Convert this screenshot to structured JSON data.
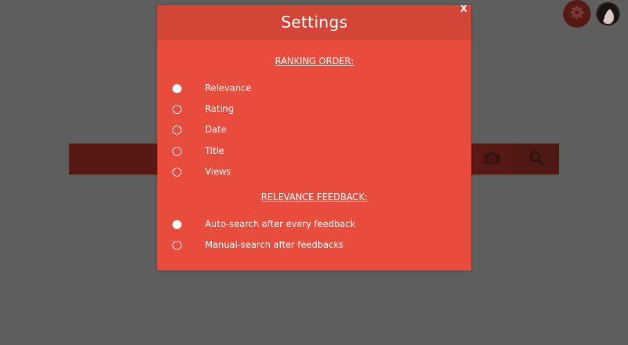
{
  "modal": {
    "title": "Settings",
    "close_label": "X"
  },
  "ranking": {
    "heading": "RANKING ORDER:",
    "options": [
      {
        "label": "Relevance",
        "selected": true
      },
      {
        "label": "Rating",
        "selected": false
      },
      {
        "label": "Date",
        "selected": false
      },
      {
        "label": "Title",
        "selected": false
      },
      {
        "label": "Views",
        "selected": false
      }
    ]
  },
  "feedback": {
    "heading": "RELEVANCE FEEDBACK:",
    "options": [
      {
        "label": "Auto-search after every feedback",
        "selected": true
      },
      {
        "label": "Manual-search after feedbacks",
        "selected": false
      }
    ]
  },
  "icons": {
    "camera": "camera-icon",
    "search": "search-icon",
    "settings": "gear-icon"
  },
  "colors": {
    "overlay": "#5e5e5e",
    "modal_body": "#e84c3d",
    "modal_header": "#d24637",
    "search_bar": "#571914",
    "gear_button": "#561914"
  }
}
